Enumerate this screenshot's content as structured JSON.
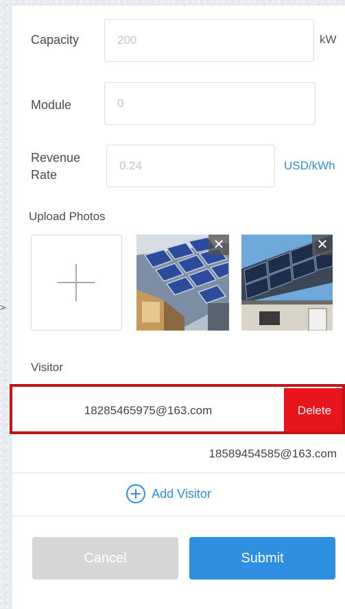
{
  "form": {
    "capacity": {
      "label": "Capacity",
      "placeholder": "200",
      "unit": "kW"
    },
    "module": {
      "label": "Module",
      "placeholder": "0"
    },
    "revenue_rate": {
      "label_line1": "Revenue",
      "label_line2": "Rate",
      "placeholder": "0.24",
      "unit": "USD/kWh"
    }
  },
  "upload": {
    "label": "Upload Photos",
    "add_glyph": "+",
    "close_glyph": "✕",
    "photos": [
      {
        "icon": "solar-roof-photo-1"
      },
      {
        "icon": "solar-roof-photo-2"
      }
    ]
  },
  "visitor": {
    "label": "Visitor",
    "items": [
      {
        "email": "18285465975@163.com",
        "action": "Delete"
      },
      {
        "email": "18589454585@163.com"
      }
    ],
    "add_label": "Add Visitor"
  },
  "actions": {
    "cancel": "Cancel",
    "submit": "Submit"
  },
  "colors": {
    "accent": "#2e8ee0",
    "delete": "#e8141c",
    "cancel_bg": "#d6d6d6",
    "highlight": "#c0141b"
  }
}
